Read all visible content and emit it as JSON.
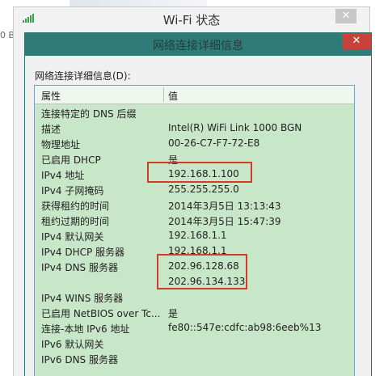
{
  "background": {
    "edge_text": "0 B"
  },
  "back_window": {
    "title": "Wi-Fi 状态",
    "close_label": "✕"
  },
  "details_window": {
    "title": "网络连接详细信息",
    "close_label": "✕",
    "caption": "网络连接详细信息(D):",
    "columns": {
      "property": "属性",
      "value": "值"
    },
    "rows": [
      {
        "property": "连接特定的 DNS 后缀",
        "value": ""
      },
      {
        "property": "描述",
        "value": "Intel(R) WiFi Link 1000 BGN"
      },
      {
        "property": "物理地址",
        "value": "00-26-C7-F7-72-E8"
      },
      {
        "property": "已启用 DHCP",
        "value": "是"
      },
      {
        "property": "IPv4 地址",
        "value": "192.168.1.100"
      },
      {
        "property": "IPv4 子网掩码",
        "value": "255.255.255.0"
      },
      {
        "property": "获得租约的时间",
        "value": "2014年3月5日 13:13:43"
      },
      {
        "property": "租约过期的时间",
        "value": "2014年3月5日 15:47:39"
      },
      {
        "property": "IPv4 默认网关",
        "value": "192.168.1.1"
      },
      {
        "property": "IPv4 DHCP 服务器",
        "value": "192.168.1.1"
      },
      {
        "property": "IPv4 DNS 服务器",
        "value": "202.96.128.68"
      },
      {
        "property": "",
        "value": "202.96.134.133"
      },
      {
        "property": "IPv4 WINS 服务器",
        "value": ""
      },
      {
        "property": "已启用 NetBIOS over Tc...",
        "value": "是"
      },
      {
        "property": "连接-本地 IPv6 地址",
        "value": "fe80::547e:cdfc:ab98:6eeb%13"
      },
      {
        "property": "IPv6 默认网关",
        "value": ""
      },
      {
        "property": "IPv6 DNS 服务器",
        "value": ""
      }
    ]
  },
  "colors": {
    "titlebar_active": "#307a78",
    "close_active": "#c7423a",
    "list_background": "#c8e6c8",
    "highlight_border": "#d63a2f"
  },
  "icons": {
    "wifi": "wifi-signal-icon"
  }
}
